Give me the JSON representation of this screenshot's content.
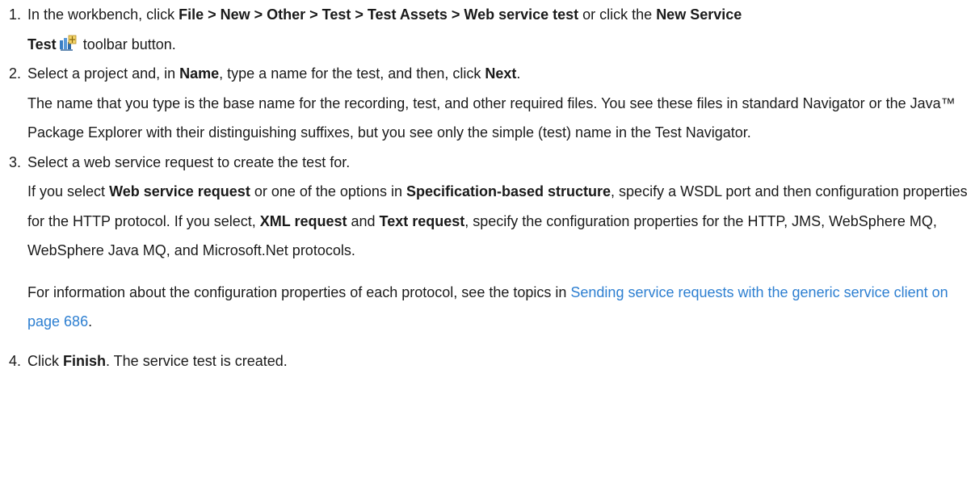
{
  "steps": [
    {
      "number": "1.",
      "intro": "In the workbench, click ",
      "menu_path": "File > New > Other > Test > Test Assets > Web service test",
      "or_text": " or click the ",
      "button_name_part1": "New Service",
      "button_name_part2": "Test",
      "icon": "new-service-test-icon",
      "tail": " toolbar button."
    },
    {
      "number": "2.",
      "part1": "Select a project and, in ",
      "name_bold": "Name",
      "part2": ", type a name for the test, and then, click ",
      "next_bold": "Next",
      "part3": ".",
      "detail": "The name that you type is the base name for the recording, test, and other required files. You see these files in standard Navigator or the Java™ Package Explorer with their distinguishing suffixes, but you see only the simple (test) name in the Test Navigator."
    },
    {
      "number": "3.",
      "main": "Select a web service request to create the test for.",
      "d1": "If you select ",
      "d_bold1": "Web service request",
      "d2": " or one of the options in ",
      "d_bold2": "Specification-based structure",
      "d3": ", specify a WSDL port and then configuration properties for the HTTP protocol. If you select, ",
      "d_bold3": "XML request",
      "d4": " and ",
      "d_bold4": "Text request",
      "d5": ", specify the configuration properties for the HTTP, JMS, WebSphere MQ, WebSphere Java MQ, and Microsoft.Net protocols.",
      "info_intro": "For information about the configuration properties of each protocol, see the topics in ",
      "info_link": "Sending service requests with the generic service client on page 686",
      "info_end": "."
    },
    {
      "number": "4.",
      "part1": "Click ",
      "finish_bold": "Finish",
      "part2": ". The service test is created."
    }
  ],
  "colors": {
    "text": "#1a1a1a",
    "link": "#2d7fd1"
  }
}
